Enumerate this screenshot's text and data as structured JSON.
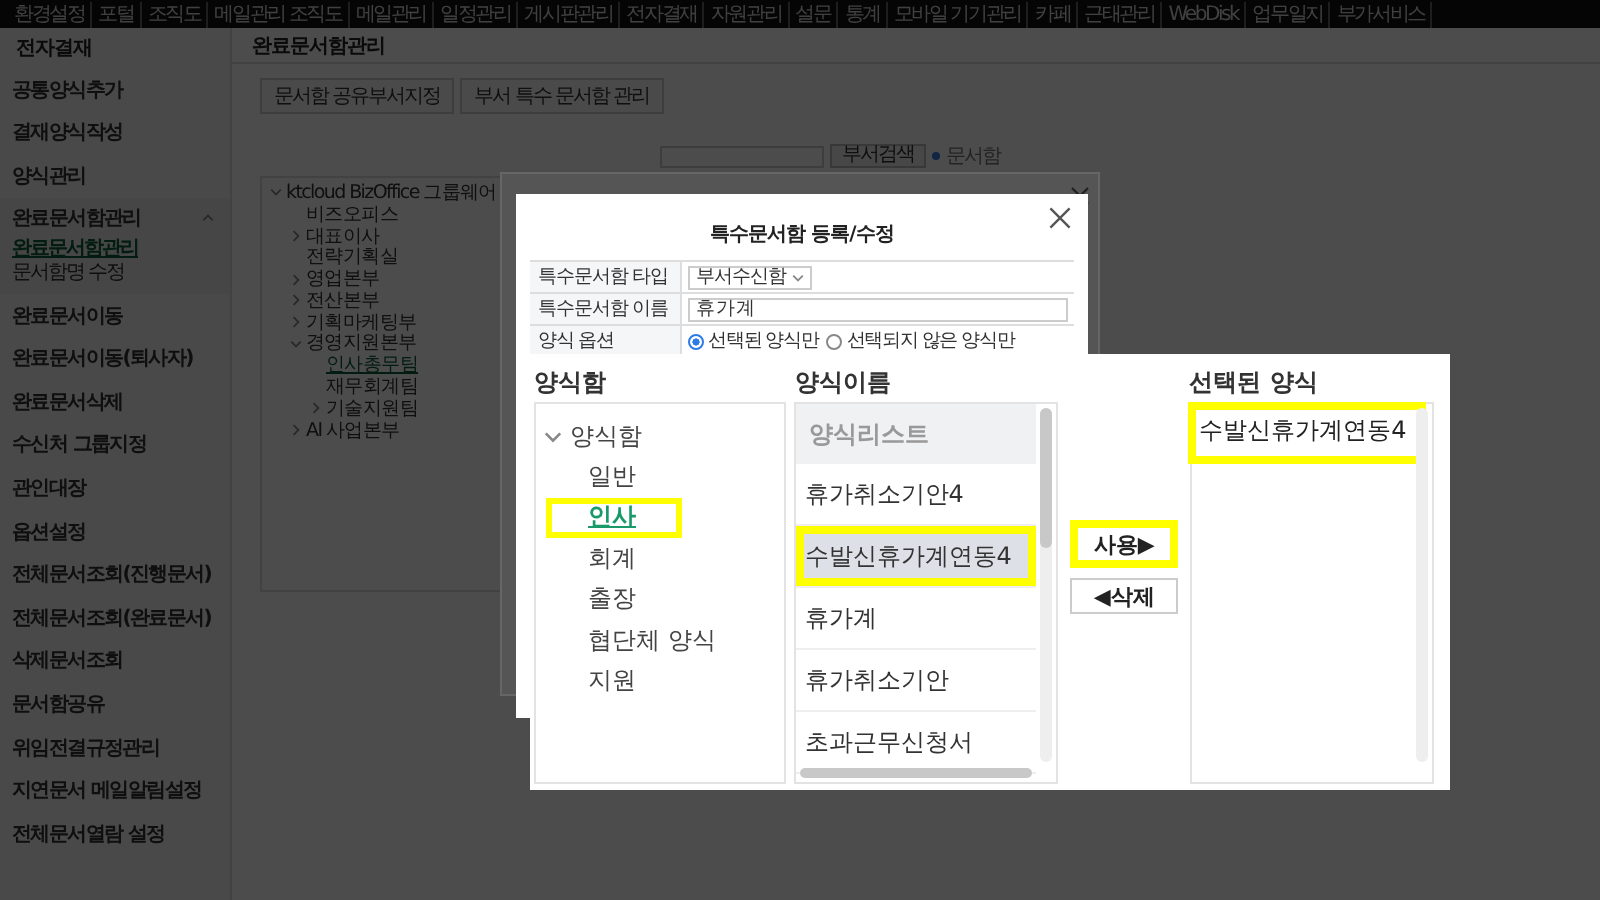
{
  "top_nav": {
    "items": [
      "환경설정",
      "포털",
      "조직도",
      "메일관리 조직도",
      "메일관리",
      "일정관리",
      "게시판관리",
      "전자결재",
      "자원관리",
      "설문",
      "통계",
      "모바일 기기관리",
      "카페",
      "근태관리",
      "WebDisk",
      "업무일지",
      "부가서비스"
    ]
  },
  "sidebar": {
    "title": "전자결재",
    "items": [
      {
        "kind": "link",
        "label": "공통양식추가"
      },
      {
        "kind": "link",
        "label": "결재양식작성"
      },
      {
        "kind": "link",
        "label": "양식관리"
      },
      {
        "kind": "group",
        "label": "완료문서함관리",
        "expanded": true,
        "children": [
          {
            "label": "완료문서함관리",
            "selected": true
          },
          {
            "label": "문서함명 수정",
            "selected": false
          }
        ]
      },
      {
        "kind": "link",
        "label": "완료문서이동"
      },
      {
        "kind": "link",
        "label": "완료문서이동(퇴사자)"
      },
      {
        "kind": "link",
        "label": "완료문서삭제"
      },
      {
        "kind": "link",
        "label": "수신처 그룹지정"
      },
      {
        "kind": "link",
        "label": "관인대장"
      },
      {
        "kind": "link",
        "label": "옵션설정"
      },
      {
        "kind": "link",
        "label": "전체문서조회(진행문서)"
      },
      {
        "kind": "link",
        "label": "전체문서조회(완료문서)"
      },
      {
        "kind": "link",
        "label": "삭제문서조회"
      },
      {
        "kind": "link",
        "label": "문서함공유"
      },
      {
        "kind": "link",
        "label": "위임전결규정관리"
      },
      {
        "kind": "link",
        "label": "지연문서 메일알림설정"
      },
      {
        "kind": "link",
        "label": "전체문서열람 설정"
      }
    ]
  },
  "main": {
    "title": "완료문서함관리",
    "buttons": [
      "문서함 공유부서지정",
      "부서 특수 문서함 관리"
    ],
    "search_button": "부서검색",
    "filter_label": "문서함",
    "tree": {
      "label": "ktcloud BizOffice 그룹웨어",
      "expanded": true,
      "children": [
        {
          "kind": "leaf",
          "label": "비즈오피스",
          "selected": false
        },
        {
          "kind": "folder",
          "label": "대표이사",
          "expanded": false,
          "selected": false
        },
        {
          "kind": "leaf",
          "label": "전략기획실",
          "selected": false
        },
        {
          "kind": "folder",
          "label": "영업본부",
          "expanded": false,
          "selected": false
        },
        {
          "kind": "folder",
          "label": "전산본부",
          "expanded": false,
          "selected": false
        },
        {
          "kind": "folder",
          "label": "기획마케팅부",
          "expanded": false,
          "selected": false
        },
        {
          "kind": "folder",
          "label": "경영지원본부",
          "expanded": true,
          "selected": false,
          "children": [
            {
              "kind": "leaf",
              "label": "인사총무팀",
              "selected": true
            },
            {
              "kind": "leaf",
              "label": "재무회계팀",
              "selected": false
            },
            {
              "kind": "folder",
              "label": "기술지원팀",
              "expanded": false,
              "selected": false
            }
          ]
        },
        {
          "kind": "folder",
          "label": "AI 사업본부",
          "expanded": false,
          "selected": false
        }
      ]
    }
  },
  "dialog": {
    "title": "특수문서함 등록/수정",
    "fields": [
      {
        "kind": "select",
        "label": "특수문서함 타입",
        "value": "부서수신함"
      },
      {
        "kind": "text",
        "label": "특수문서함 이름",
        "value": "휴가계"
      },
      {
        "kind": "radio",
        "label": "양식 옵션",
        "options": [
          {
            "label": "선택된 양식만",
            "selected": true
          },
          {
            "label": "선택되지 않은 양식만",
            "selected": false
          }
        ]
      }
    ]
  },
  "callout": {
    "form_boxes": {
      "heading": "양식함",
      "root": {
        "label": "양식함",
        "expanded": true
      },
      "items": [
        {
          "label": "일반",
          "selected": false,
          "highlighted": false
        },
        {
          "label": "인사",
          "selected": true,
          "highlighted": true
        },
        {
          "label": "회계",
          "selected": false,
          "highlighted": false
        },
        {
          "label": "출장",
          "selected": false,
          "highlighted": false
        },
        {
          "label": "협단체 양식",
          "selected": false,
          "highlighted": false
        },
        {
          "label": "지원",
          "selected": false,
          "highlighted": false
        }
      ]
    },
    "form_names": {
      "heading": "양식이름",
      "list_header": "양식리스트",
      "items": [
        {
          "label": "휴가취소기안4",
          "selected": false,
          "highlighted": false
        },
        {
          "label": "수발신휴가계연동4",
          "selected": true,
          "highlighted": true
        },
        {
          "label": "휴가계",
          "selected": false,
          "highlighted": false
        },
        {
          "label": "휴가취소기안",
          "selected": false,
          "highlighted": false
        },
        {
          "label": "초과근무신청서",
          "selected": false,
          "highlighted": false
        }
      ]
    },
    "actions": [
      {
        "label": "사용▶",
        "highlighted": true
      },
      {
        "label": "◀삭제",
        "highlighted": false
      }
    ],
    "selected_forms": {
      "heading": "선택된 양식",
      "items": [
        {
          "label": "수발신휴가계연동4",
          "highlighted": true
        }
      ]
    }
  }
}
